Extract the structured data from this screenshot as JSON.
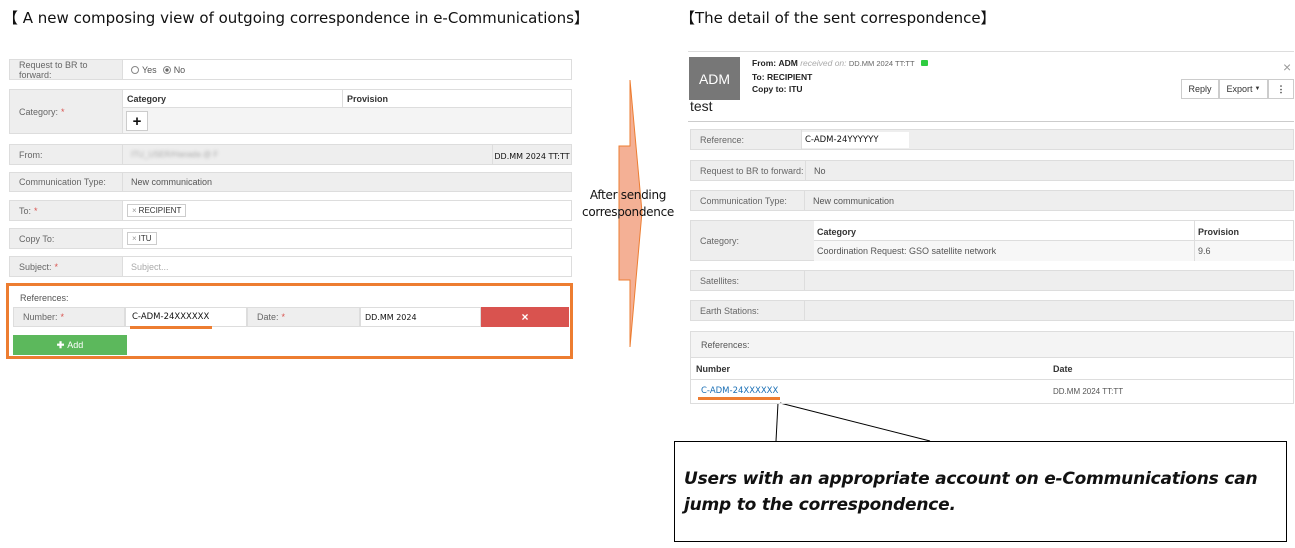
{
  "left": {
    "title": "【 A new composing view of outgoing correspondence in e-Communications】",
    "request_label": "Request to BR to forward:",
    "yes": "Yes",
    "no": "No",
    "category_label": "Category:",
    "col_category": "Category",
    "col_provision": "Provision",
    "add_symbol": "+",
    "from_label": "From:",
    "from_value": "ITU_USER/Hanada @ F",
    "from_date": "DD.MM 2024 TT:TT",
    "comm_type_label": "Communication Type:",
    "comm_type_value": "New communication",
    "to_label": "To:",
    "to_value": "RECIPIENT",
    "copy_label": "Copy To:",
    "copy_value": "ITU",
    "subject_label": "Subject:",
    "subject_placeholder": "Subject...",
    "references_label": "References:",
    "number_label": "Number:",
    "number_value": "C-ADM-24XXXXXX",
    "date_label": "Date:",
    "date_value": "DD.MM 2024",
    "remove_symbol": "×",
    "add_label": "Add",
    "required": "*",
    "tag_x": "×"
  },
  "arrow": {
    "text_line1": "After sending",
    "text_line2": "correspondence"
  },
  "right": {
    "title": "【The detail of the sent correspondence】",
    "avatar": "ADM",
    "from_prefix": "From:",
    "from": "ADM",
    "received_on": "received on:",
    "received_date": "DD.MM 2024 TT:TT",
    "to_line": "To: RECIPIENT",
    "copy_line": "Copy to: ITU",
    "subject": "test",
    "reply": "Reply",
    "export": "Export",
    "more": "⋮",
    "close": "×",
    "reference_label": "Reference:",
    "reference_value": "C-ADM-24YYYYYY",
    "request_label": "Request to BR to forward:",
    "request_value": "No",
    "comm_type_label": "Communication Type:",
    "comm_type_value": "New communication",
    "category_label": "Category:",
    "col_category": "Category",
    "col_provision": "Provision",
    "category_value": "Coordination Request: GSO satellite network",
    "provision_value": "9.6",
    "satellites_label": "Satellites:",
    "earth_label": "Earth Stations:",
    "references_label": "References:",
    "col_number": "Number",
    "col_date": "Date",
    "ref_number": "C-ADM-24XXXXXX",
    "ref_date": "DD.MM 2024 TT:TT"
  },
  "callout": {
    "line1": "Users with an appropriate account on e-Communications can",
    "line2": "jump to the correspondence."
  },
  "colors": {
    "highlight": "#ed7d31",
    "danger": "#d9534f",
    "success": "#5cb85c",
    "link": "#1a6fb5",
    "arrow_fill": "#f4b095"
  }
}
